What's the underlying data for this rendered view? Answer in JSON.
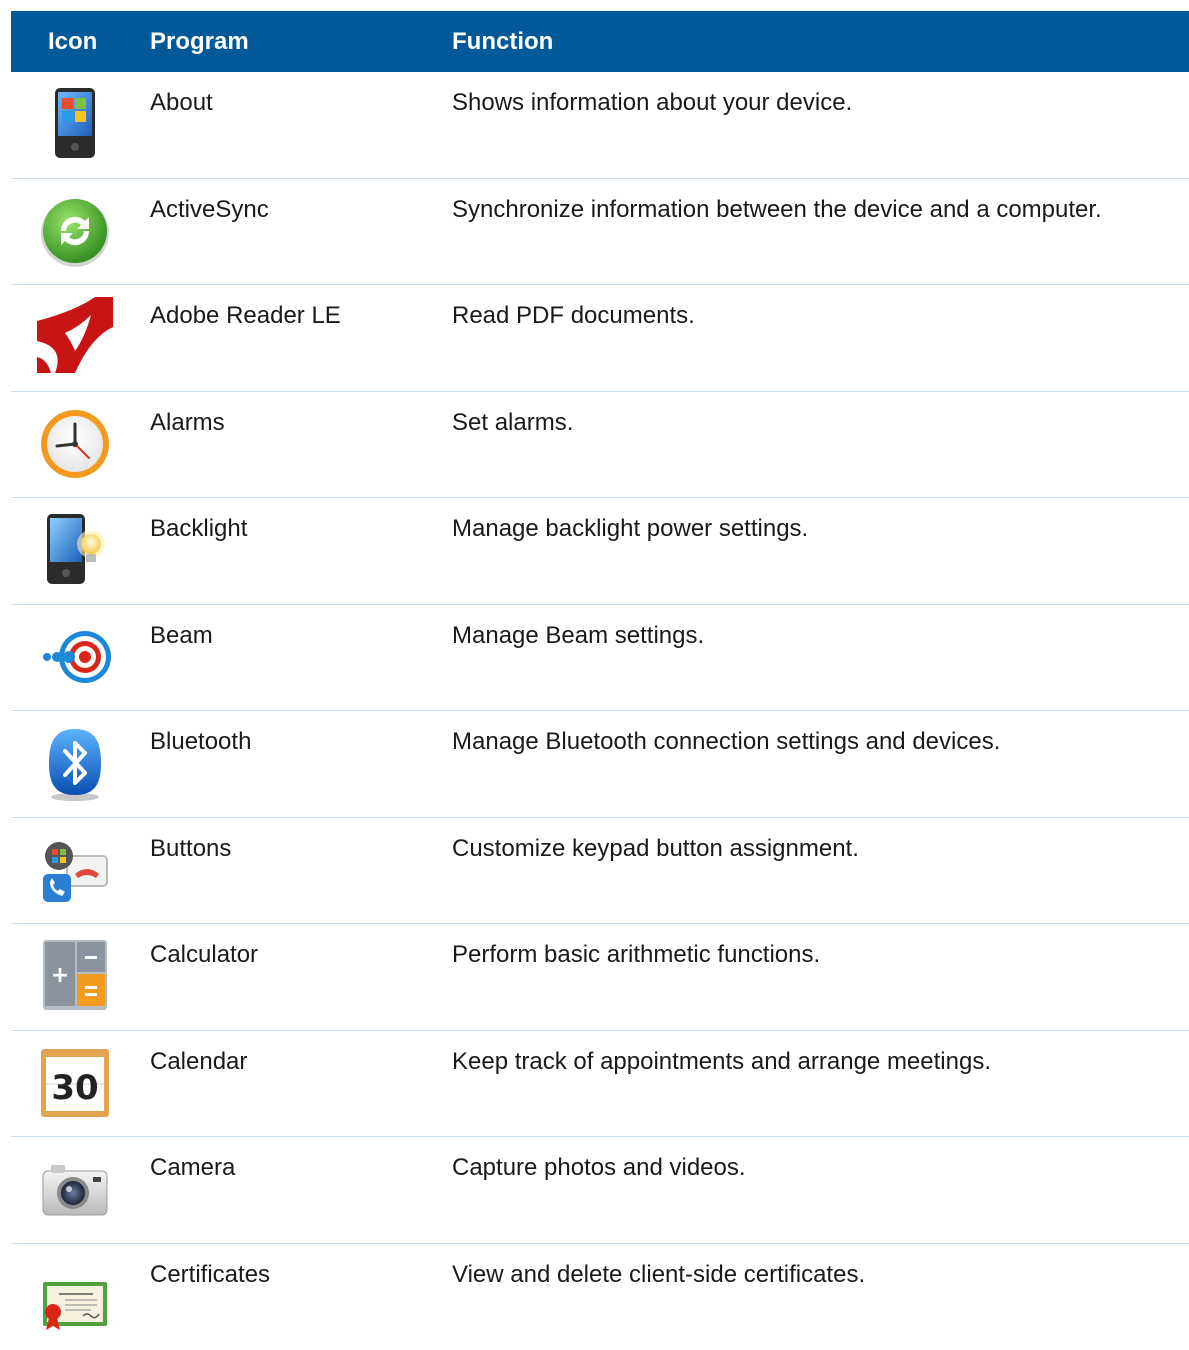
{
  "header": {
    "icon_label": "Icon",
    "program_label": "Program",
    "function_label": "Function"
  },
  "colors": {
    "header_bg": "#01599a",
    "row_divider": "#cfe0ee"
  },
  "rows": [
    {
      "icon": "device-about-icon",
      "program": "About",
      "function": "Shows information about your device."
    },
    {
      "icon": "activesync-icon",
      "program": "ActiveSync",
      "function": "Synchronize information between the device and a computer."
    },
    {
      "icon": "adobe-reader-icon",
      "program": "Adobe Reader LE",
      "function": "Read PDF documents."
    },
    {
      "icon": "alarm-clock-icon",
      "program": "Alarms",
      "function": "Set alarms."
    },
    {
      "icon": "backlight-icon",
      "program": "Backlight",
      "function": "Manage backlight power settings."
    },
    {
      "icon": "beam-icon",
      "program": "Beam",
      "function": "Manage Beam settings."
    },
    {
      "icon": "bluetooth-icon",
      "program": "Bluetooth",
      "function": "Manage Bluetooth connection settings and devices."
    },
    {
      "icon": "buttons-icon",
      "program": "Buttons",
      "function": "Customize keypad button assignment."
    },
    {
      "icon": "calculator-icon",
      "program": "Calculator",
      "function": "Perform basic arithmetic functions."
    },
    {
      "icon": "calendar-icon",
      "program": "Calendar",
      "function": "Keep track of appointments and arrange meetings."
    },
    {
      "icon": "camera-icon",
      "program": "Camera",
      "function": "Capture photos and videos."
    },
    {
      "icon": "certificate-icon",
      "program": "Certificates",
      "function": "View and delete client-side certificates."
    }
  ]
}
